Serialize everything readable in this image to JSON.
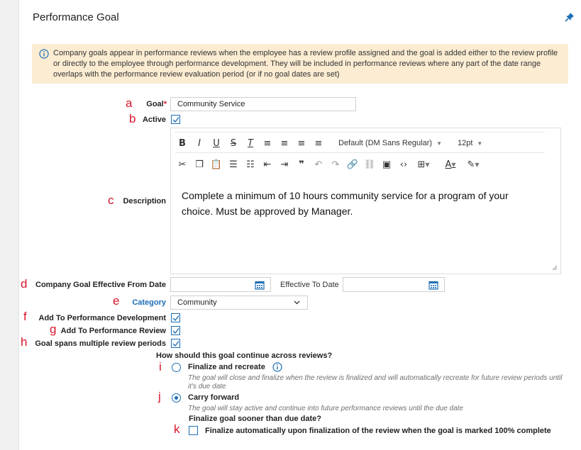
{
  "panel": {
    "title": "Performance Goal"
  },
  "info": {
    "text": "Company goals appear in performance reviews when the employee has a review profile assigned and the goal is added either to the review profile or directly to the employee through performance development. They will be included in performance reviews where any part of the date range overlaps with the performance review evaluation period (or if no goal dates are set)"
  },
  "markers": {
    "a": "a",
    "b": "b",
    "c": "c",
    "d": "d",
    "e": "e",
    "f": "f",
    "g": "g",
    "h": "h",
    "i": "i",
    "j": "j",
    "k": "k"
  },
  "fields": {
    "goal": {
      "label": "Goal",
      "required_mark": "*",
      "value": "Community Service"
    },
    "active": {
      "label": "Active",
      "checked": true
    },
    "description": {
      "label": "Description",
      "content": "Complete a minimum of 10 hours community service for a program of your choice.  Must be approved by Manager."
    },
    "effective_from": {
      "label": "Company Goal Effective From Date",
      "value": ""
    },
    "effective_to": {
      "label": "Effective To Date",
      "value": ""
    },
    "category": {
      "label": "Category",
      "value": "Community"
    },
    "add_to_development": {
      "label": "Add To Performance Development",
      "checked": true
    },
    "add_to_review": {
      "label": "Add To Performance Review",
      "checked": true
    },
    "spans_multiple": {
      "label": "Goal spans multiple review periods",
      "checked": true
    }
  },
  "editor_toolbar": {
    "font_family": "Default (DM Sans Regular)",
    "font_size": "12pt"
  },
  "continuation": {
    "question": "How should this goal continue across reviews?",
    "options": [
      {
        "title": "Finalize and recreate",
        "description": "The goal will close and finalize when the review is finalized and will automatically recreate for future review periods until it's due date",
        "selected": false
      },
      {
        "title": "Carry forward",
        "description": "The goal will stay active and continue into future performance reviews until the due date",
        "selected": true
      }
    ],
    "finalize_question": "Finalize goal sooner than due date?",
    "finalize_option": {
      "label": "Finalize automatically upon finalization of the review when the goal is marked 100% complete",
      "checked": false
    }
  },
  "colors": {
    "accent": "#1c6eb5",
    "marker": "#d8142a",
    "info_bg": "#fbecd2"
  }
}
